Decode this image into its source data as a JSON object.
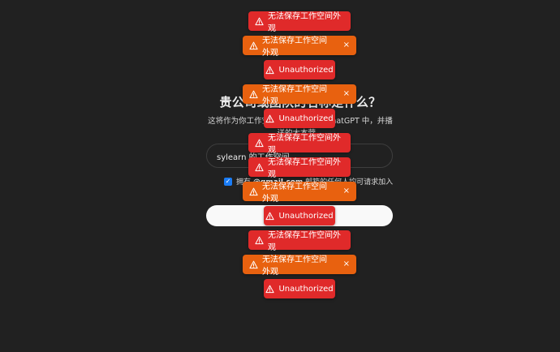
{
  "form": {
    "heading": "贵公司或团队的名称是什么？",
    "description": "这将作为你工作空间的名称显示在 ChatGPT 中，并播送的大本营。",
    "name_input_value": "sylearn 的工作空间",
    "checkbox_checked": true,
    "checkbox_label_prefix": "拥有 ",
    "checkbox_label_domain": "@gmail.com",
    "checkbox_label_suffix": " 邮箱的任何人均可请求加入",
    "continue_label": ""
  },
  "toasts": {
    "t1": {
      "message": "无法保存工作空间外观",
      "variant": "error",
      "color": "#e02a2a",
      "icon": "warning-triangle-icon"
    },
    "t2": {
      "message": "无法保存工作空间外观",
      "variant": "warning",
      "color": "#e8610f",
      "icon": "warning-triangle-icon",
      "close": "×"
    },
    "t3": {
      "message": "Unauthorized",
      "variant": "error",
      "color": "#e02a2a",
      "icon": "warning-triangle-icon"
    },
    "t4": {
      "message": "无法保存工作空间外观",
      "variant": "warning",
      "color": "#e8610f",
      "icon": "warning-triangle-icon",
      "close": "×"
    },
    "t5": {
      "message": "Unauthorized",
      "variant": "error",
      "color": "#e02a2a",
      "icon": "warning-triangle-icon"
    },
    "t6": {
      "message": "无法保存工作空间外观",
      "variant": "error",
      "color": "#e02a2a",
      "icon": "warning-triangle-icon"
    },
    "t7": {
      "message": "无法保存工作空间外观",
      "variant": "error",
      "color": "#e02a2a",
      "icon": "warning-triangle-icon"
    },
    "t8": {
      "message": "无法保存工作空间外观",
      "variant": "warning",
      "color": "#e8610f",
      "icon": "warning-triangle-icon",
      "close": "×"
    },
    "t9": {
      "message": "Unauthorized",
      "variant": "error",
      "color": "#e02a2a",
      "icon": "warning-triangle-icon"
    },
    "t10": {
      "message": "无法保存工作空间外观",
      "variant": "error",
      "color": "#e02a2a",
      "icon": "warning-triangle-icon"
    },
    "t11": {
      "message": "无法保存工作空间外观",
      "variant": "warning",
      "color": "#e8610f",
      "icon": "warning-triangle-icon",
      "close": "×"
    },
    "t12": {
      "message": "Unauthorized",
      "variant": "error",
      "color": "#e02a2a",
      "icon": "warning-triangle-icon"
    }
  },
  "theme": {
    "background": "#212121",
    "error_color": "#e02a2a",
    "warning_color": "#e8610f",
    "checkbox_color": "#1a7cf5"
  }
}
